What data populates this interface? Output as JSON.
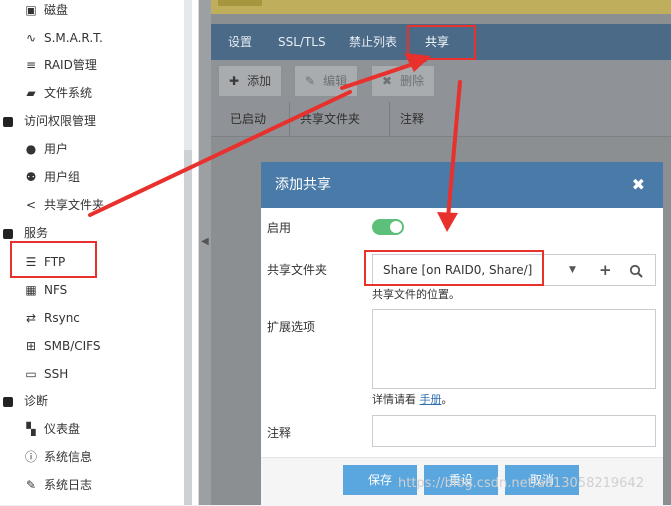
{
  "sidebar": {
    "items": [
      {
        "label": "磁盘",
        "icon": "disk-icon"
      },
      {
        "label": "S.M.A.R.T.",
        "icon": "pulse-icon"
      },
      {
        "label": "RAID管理",
        "icon": "database-icon"
      },
      {
        "label": "文件系统",
        "icon": "folder-icon"
      }
    ],
    "access_group": {
      "label": "访问权限管理",
      "items": [
        {
          "label": "用户",
          "icon": "user-icon"
        },
        {
          "label": "用户组",
          "icon": "users-icon"
        },
        {
          "label": "共享文件夹",
          "icon": "share-icon"
        }
      ]
    },
    "services_group": {
      "label": "服务",
      "items": [
        {
          "label": "FTP",
          "icon": "ftp-icon"
        },
        {
          "label": "NFS",
          "icon": "nfs-icon"
        },
        {
          "label": "Rsync",
          "icon": "rsync-icon"
        },
        {
          "label": "SMB/CIFS",
          "icon": "windows-icon"
        },
        {
          "label": "SSH",
          "icon": "terminal-icon"
        }
      ]
    },
    "diag_group": {
      "label": "诊断",
      "items": [
        {
          "label": "仪表盘",
          "icon": "dashboard-icon"
        },
        {
          "label": "系统信息",
          "icon": "info-icon"
        },
        {
          "label": "系统日志",
          "icon": "log-icon"
        }
      ]
    }
  },
  "tabs": [
    "设置",
    "SSL/TLS",
    "禁止列表",
    "共享"
  ],
  "active_tab": "共享",
  "toolbar": {
    "add": "添加",
    "edit": "编辑",
    "delete": "删除"
  },
  "table": {
    "headers": [
      "已启动",
      "共享文件夹",
      "注释"
    ]
  },
  "dialog": {
    "title": "添加共享",
    "enable_label": "启用",
    "enabled": true,
    "share_label": "共享文件夹",
    "share_value": "Share [on RAID0, Share/]",
    "share_help": "共享文件的位置。",
    "ext_label": "扩展选项",
    "ext_help_prefix": "详情请看",
    "ext_help_link": "手册",
    "ext_help_suffix": "。",
    "note_label": "注释",
    "save": "保存",
    "reset": "重设",
    "cancel": "取消"
  },
  "watermark": "https://blog.csdn.net/aa13058219642",
  "colors": {
    "tab_bar": "#4a6a88",
    "dialog_header": "#4a7aa8",
    "toggle_on": "#5dc07a",
    "primary_button": "#5aa6de",
    "annotation_red": "#e8302c"
  }
}
